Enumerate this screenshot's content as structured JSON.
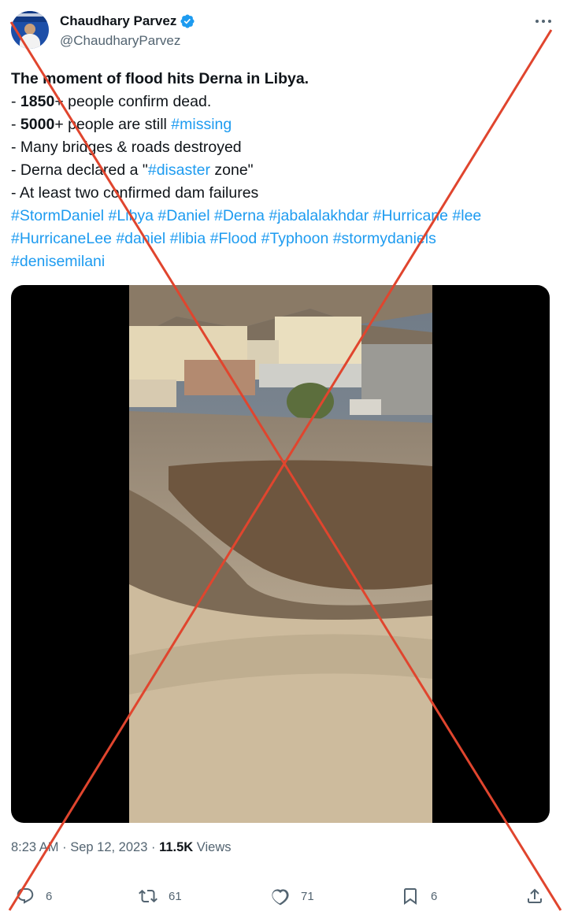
{
  "user": {
    "name": "Chaudhary Parvez",
    "handle": "@ChaudharyParvez"
  },
  "icons": {
    "verified": "verified-badge-icon",
    "more": "more-horizontal-icon",
    "reply": "reply-icon",
    "retweet": "retweet-icon",
    "like": "heart-icon",
    "bookmark": "bookmark-icon",
    "share": "share-icon"
  },
  "colors": {
    "link": "#1d9bf0",
    "verified": "#1d9bf0",
    "overlay_cross": "#e0452e",
    "muted": "#536471"
  },
  "tweet": {
    "title": "The moment of flood hits Derna in Libya.",
    "lines": {
      "l1": {
        "prefix": "- ",
        "bold": "1850",
        "rest": "+ people confirm dead."
      },
      "l2": {
        "prefix": "- ",
        "bold": "5000",
        "rest": "+ people are still ",
        "tag": "#missing"
      },
      "l3": "- Many bridges & roads destroyed",
      "l4": {
        "prefix": "- Derna declared a \"",
        "tag": "#disaster",
        "rest": " zone\""
      },
      "l5": "- At least two confirmed dam failures"
    },
    "hashtags_line1": "#StormDaniel #Libya #Daniel #Derna #jabalalakhdar #Hurricane #lee",
    "hashtags_line2": "#HurricaneLee #daniel #libia #Flood #Typhoon #stormydaniels",
    "hashtags_line3": "#denisemilani"
  },
  "meta": {
    "time": "8:23 AM",
    "sep1": " · ",
    "date": "Sep 12, 2023",
    "sep2": " · ",
    "views_count": "11.5K",
    "views_label": " Views"
  },
  "actions": {
    "replies": "6",
    "retweets": "61",
    "likes": "71",
    "bookmarks": "6"
  }
}
